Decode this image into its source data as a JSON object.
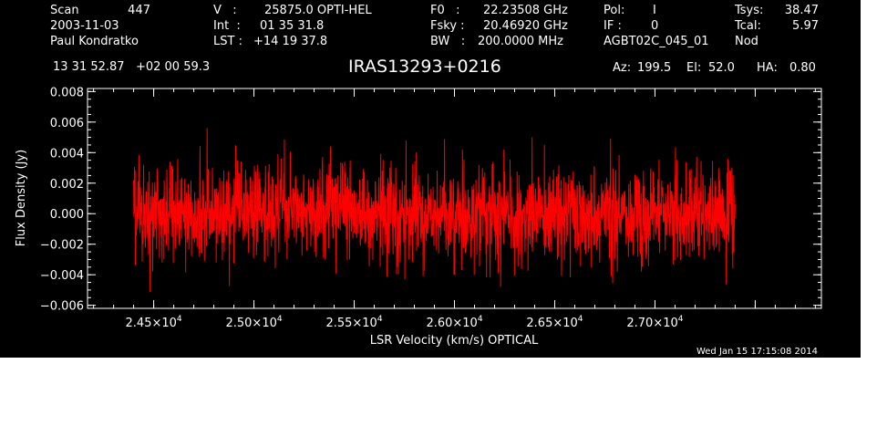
{
  "header": {
    "scan_label": "Scan",
    "scan_value": "447",
    "date": "2003-11-03",
    "observer": "Paul Kondratko",
    "v_label": "V   :",
    "v_value": "25875.0 OPTI-HEL",
    "int_label": "Int  :",
    "int_value": "01 35 31.8",
    "lst_label": "LST :",
    "lst_value": "+14 19 37.8",
    "f0_label": "F0   :",
    "f0_value": "22.23508 GHz",
    "fsky_label": "Fsky :",
    "fsky_value": "20.46920 GHz",
    "bw_label": "BW   :",
    "bw_value": "200.0000 MHz",
    "pol_label": "Pol:",
    "pol_value": "I",
    "if_label": "IF :",
    "if_value": "0",
    "project": "AGBT02C_045_01",
    "tsys_label": "Tsys:",
    "tsys_value": "38.47",
    "tcal_label": "Tcal:",
    "tcal_value": "5.97",
    "procedure": "Nod",
    "coords": "13 31 52.87   +02 00 59.3",
    "source": "IRAS13293+0216",
    "az_label": "Az:",
    "az_value": "199.5",
    "el_label": "El:",
    "el_value": "52.0",
    "ha_label": "HA:",
    "ha_value": "0.80"
  },
  "timestamp": "Wed Jan 15 17:15:08 2014",
  "chart_data": {
    "type": "line",
    "xlabel": "LSR Velocity (km/s) OPTICAL",
    "ylabel": "Flux Density (Jy)",
    "xlim": [
      24170,
      27830
    ],
    "ylim": [
      -0.0062,
      0.0082
    ],
    "x_ticks": [
      24500,
      25000,
      25500,
      26000,
      26500,
      27000
    ],
    "x_tick_labels": [
      {
        "mantissa": "2.45×10",
        "exp": "4"
      },
      {
        "mantissa": "2.50×10",
        "exp": "4"
      },
      {
        "mantissa": "2.55×10",
        "exp": "4"
      },
      {
        "mantissa": "2.60×10",
        "exp": "4"
      },
      {
        "mantissa": "2.65×10",
        "exp": "4"
      },
      {
        "mantissa": "2.70×10",
        "exp": "4"
      }
    ],
    "y_ticks": [
      -0.006,
      -0.004,
      -0.002,
      0.0,
      0.002,
      0.004,
      0.006,
      0.008
    ],
    "y_tick_labels": [
      "−0.006",
      "−0.004",
      "−0.002",
      "0.000",
      "0.002",
      "0.004",
      "0.006",
      "0.008"
    ],
    "grid": false,
    "series": [
      {
        "color": "#ff0000",
        "x_start": 24400,
        "x_end": 27400,
        "n_points": 2048,
        "mean": 0.0,
        "rms": 0.0016,
        "y_min": -0.0055,
        "y_max": 0.0056
      }
    ]
  }
}
